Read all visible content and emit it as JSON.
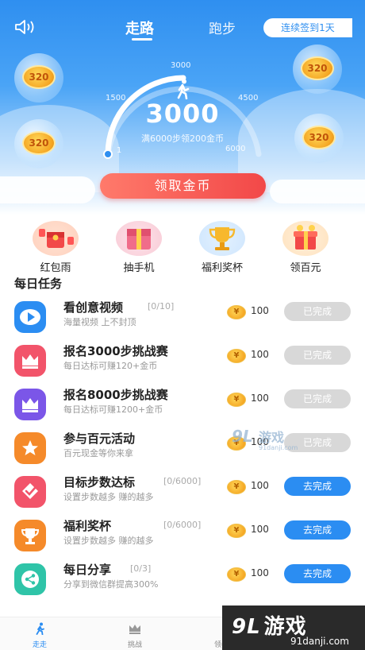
{
  "header": {
    "tabs": [
      {
        "label": "走路",
        "active": true
      },
      {
        "label": "跑步",
        "active": false
      }
    ],
    "checkin_label": "连续签到1天",
    "speaker_icon": "speaker-icon"
  },
  "gauge": {
    "steps": "3000",
    "ticks": [
      "1",
      "1500",
      "3000",
      "4500",
      "6000"
    ],
    "note": "满6000步领200金币",
    "progress_fraction": 0.5
  },
  "coins": [
    "320",
    "320",
    "320",
    "320"
  ],
  "claim_button": "领取金币",
  "quick_entries": [
    {
      "label": "红包雨",
      "icon": "red-envelope-rain-icon"
    },
    {
      "label": "抽手机",
      "icon": "phone-lottery-icon"
    },
    {
      "label": "福利奖杯",
      "icon": "trophy-icon"
    },
    {
      "label": "领百元",
      "icon": "gift-box-icon"
    }
  ],
  "daily_tasks": {
    "title": "每日任务",
    "items": [
      {
        "name": "看创意视频",
        "progress": "[0/10]",
        "desc": "海量视频 上不封顶",
        "reward": "100",
        "button": "已完成",
        "state": "done",
        "color": "#2b8df2",
        "icon": "play-icon"
      },
      {
        "name": "报名3000步挑战赛",
        "progress": "",
        "desc": "每日达标可赚120+金币",
        "reward": "100",
        "button": "已完成",
        "state": "done",
        "color": "#f2546a",
        "icon": "crown-icon"
      },
      {
        "name": "报名8000步挑战赛",
        "progress": "",
        "desc": "每日达标可赚1200+金币",
        "reward": "100",
        "button": "已完成",
        "state": "done",
        "color": "#7b56e8",
        "icon": "crown-icon"
      },
      {
        "name": "参与百元活动",
        "progress": "",
        "desc": "百元现金等你来拿",
        "reward": "100",
        "button": "已完成",
        "state": "done",
        "color": "#f58a2a",
        "icon": "star-icon"
      },
      {
        "name": "目标步数达标",
        "progress": "[0/6000]",
        "desc": "设置步数越多 赚的越多",
        "reward": "100",
        "button": "去完成",
        "state": "go",
        "color": "#f2546a",
        "icon": "check-icon"
      },
      {
        "name": "福利奖杯",
        "progress": "[0/6000]",
        "desc": "设置步数越多 赚的越多",
        "reward": "100",
        "button": "去完成",
        "state": "go",
        "color": "#f58a2a",
        "icon": "trophy-icon"
      },
      {
        "name": "每日分享",
        "progress": "[0/3]",
        "desc": "分享到微信群提高300%",
        "reward": "100",
        "button": "去完成",
        "state": "go",
        "color": "#2fc4a8",
        "icon": "share-icon"
      }
    ]
  },
  "bottom_nav": [
    {
      "label": "走走",
      "icon": "walker-icon",
      "active": true
    },
    {
      "label": "挑战",
      "icon": "crown-icon",
      "active": false
    },
    {
      "label": "领券中心",
      "icon": "coupon-icon",
      "active": false
    }
  ],
  "watermark": {
    "mid_logo": "9L",
    "mid_text": "游戏",
    "mid_url": "91danji.com",
    "corner_logo": "9L",
    "corner_text": "游戏",
    "corner_url": "91danji.com"
  }
}
